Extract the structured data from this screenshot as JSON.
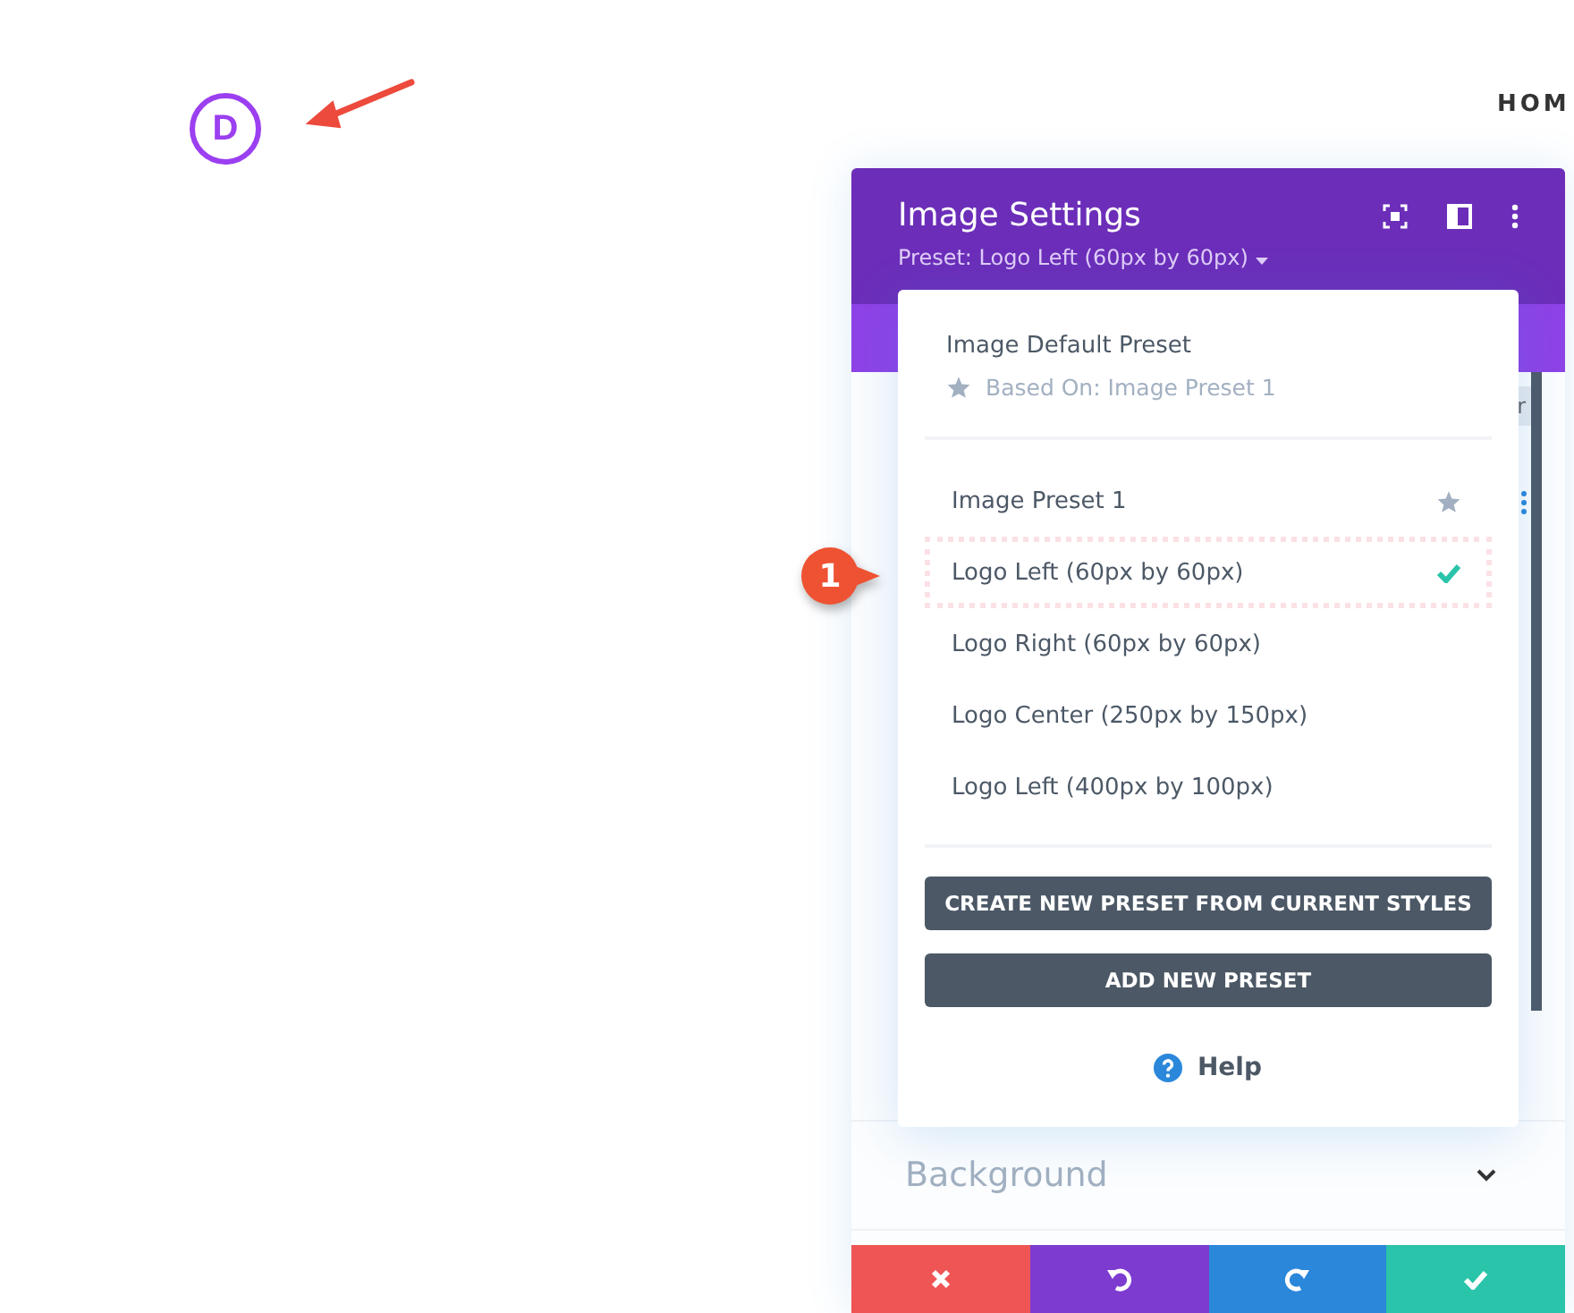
{
  "logo": {
    "letter": "D"
  },
  "nav": {
    "item": "HOM"
  },
  "panel": {
    "title": "Image Settings",
    "preset_label": "Preset: Logo Left (60px by 60px)",
    "hidden_button_fragment": "r",
    "section": "Background",
    "footer": [
      {
        "kind": "cancel"
      },
      {
        "kind": "undo"
      },
      {
        "kind": "redo"
      },
      {
        "kind": "save"
      }
    ]
  },
  "dropdown": {
    "default": {
      "name": "Image Default Preset",
      "based_on": "Based On: Image Preset 1"
    },
    "presets": [
      {
        "name": "Image Preset 1",
        "selected": false,
        "is_default": true
      },
      {
        "name": "Logo Left (60px by 60px)",
        "selected": true,
        "is_default": false
      },
      {
        "name": "Logo Right (60px by 60px)",
        "selected": false,
        "is_default": false
      },
      {
        "name": "Logo Center (250px by 150px)",
        "selected": false,
        "is_default": false
      },
      {
        "name": "Logo Left (400px by 100px)",
        "selected": false,
        "is_default": false
      }
    ],
    "buttons": [
      "CREATE NEW PRESET FROM CURRENT STYLES",
      "ADD NEW PRESET"
    ],
    "help": "Help"
  },
  "callout": {
    "number": "1"
  }
}
